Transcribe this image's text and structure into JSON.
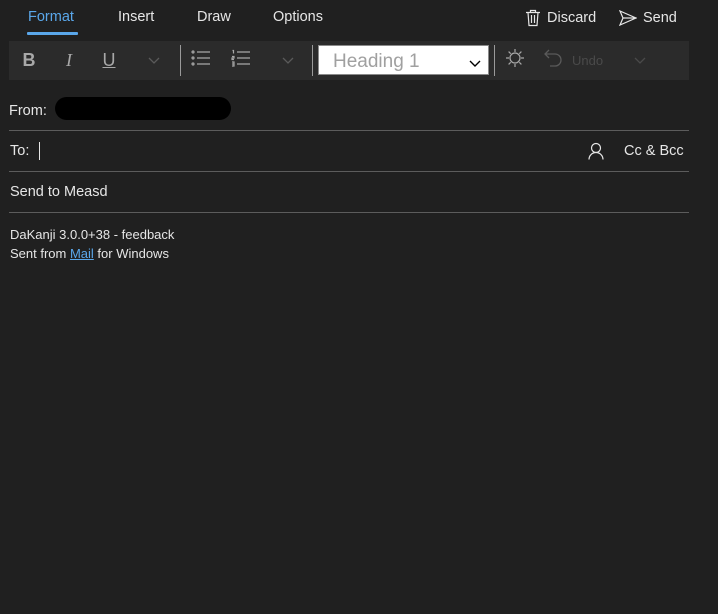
{
  "tabs": [
    {
      "label": "Format",
      "active": true
    },
    {
      "label": "Insert",
      "active": false
    },
    {
      "label": "Draw",
      "active": false
    },
    {
      "label": "Options",
      "active": false
    }
  ],
  "actions": {
    "discard_label": "Discard",
    "send_label": "Send"
  },
  "toolbar": {
    "bold_label": "B",
    "italic_label": "I",
    "underline_label": "U",
    "heading_value": "Heading 1",
    "undo_label": "Undo",
    "icons": [
      "bullet-list-icon",
      "numbered-list-icon",
      "styles-icon",
      "undo-icon"
    ]
  },
  "compose": {
    "from_label": "From:",
    "to_label": "To:",
    "cc_bcc_label": "Cc & Bcc",
    "subject": "Send to Measd",
    "body_line1": "DaKanji 3.0.0+38 - feedback",
    "signature_prefix": "Sent from ",
    "signature_link": "Mail",
    "signature_suffix": " for Windows"
  },
  "colors": {
    "background": "#202020",
    "toolbar": "#2b2b2b",
    "accent": "#5aa7ea",
    "divider": "#5c5c5c"
  }
}
